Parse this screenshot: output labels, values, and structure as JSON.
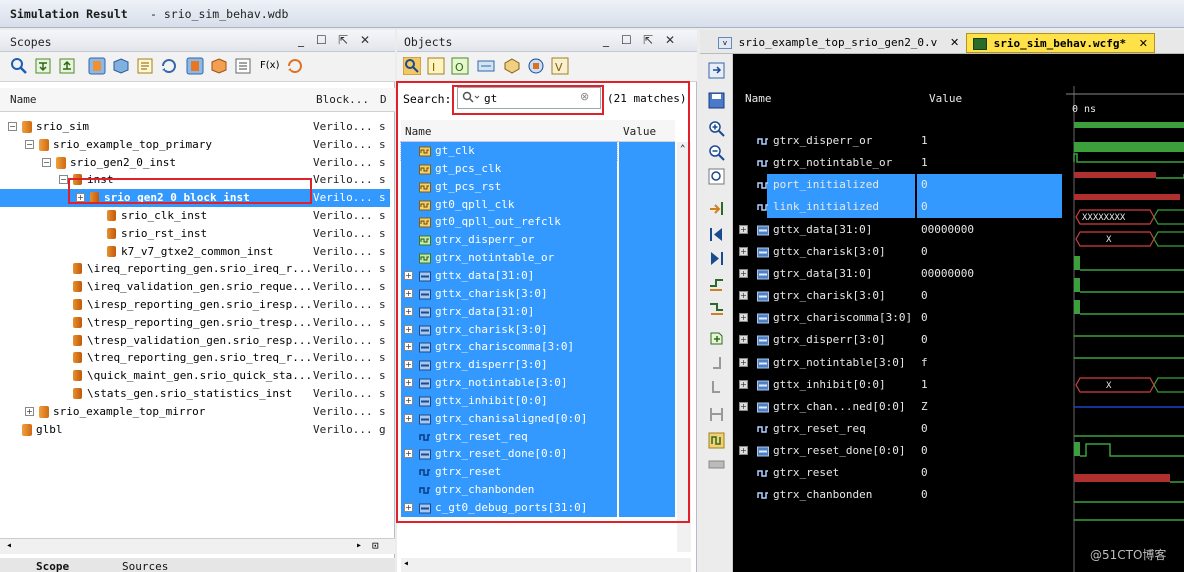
{
  "window": {
    "title": "Simulation Result",
    "subtitle": "- srio_sim_behav.wdb"
  },
  "scopes": {
    "title": "Scopes",
    "columns": {
      "name": "Name",
      "block": "Block...",
      "design": "D"
    },
    "rows": [
      {
        "name": "srio_sim",
        "block": "Verilo...",
        "d": "s",
        "level": 0,
        "exp": "−"
      },
      {
        "name": "srio_example_top_primary",
        "block": "Verilo...",
        "d": "s",
        "level": 1,
        "exp": "−"
      },
      {
        "name": "srio_gen2_0_inst",
        "block": "Verilo...",
        "d": "s",
        "level": 2,
        "exp": "−"
      },
      {
        "name": "inst",
        "block": "Verilo...",
        "d": "s",
        "level": 3,
        "exp": "−"
      },
      {
        "name": "srio_gen2_0_block_inst",
        "block": "Verilo...",
        "d": "s",
        "level": 4,
        "exp": "+",
        "selected": true
      },
      {
        "name": "srio_clk_inst",
        "block": "Verilo...",
        "d": "s",
        "level": 5,
        "exp": ""
      },
      {
        "name": "srio_rst_inst",
        "block": "Verilo...",
        "d": "s",
        "level": 5,
        "exp": ""
      },
      {
        "name": "k7_v7_gtxe2_common_inst",
        "block": "Verilo...",
        "d": "s",
        "level": 5,
        "exp": ""
      },
      {
        "name": "\\ireq_reporting_gen.srio_ireq_r...",
        "block": "Verilo...",
        "d": "s",
        "level": 3,
        "exp": ""
      },
      {
        "name": "\\ireq_validation_gen.srio_reque...",
        "block": "Verilo...",
        "d": "s",
        "level": 3,
        "exp": ""
      },
      {
        "name": "\\iresp_reporting_gen.srio_iresp...",
        "block": "Verilo...",
        "d": "s",
        "level": 3,
        "exp": ""
      },
      {
        "name": "\\tresp_reporting_gen.srio_tresp...",
        "block": "Verilo...",
        "d": "s",
        "level": 3,
        "exp": ""
      },
      {
        "name": "\\tresp_validation_gen.srio_resp...",
        "block": "Verilo...",
        "d": "s",
        "level": 3,
        "exp": ""
      },
      {
        "name": "\\treq_reporting_gen.srio_treq_r...",
        "block": "Verilo...",
        "d": "s",
        "level": 3,
        "exp": ""
      },
      {
        "name": "\\quick_maint_gen.srio_quick_sta...",
        "block": "Verilo...",
        "d": "s",
        "level": 3,
        "exp": ""
      },
      {
        "name": "\\stats_gen.srio_statistics_inst",
        "block": "Verilo...",
        "d": "s",
        "level": 3,
        "exp": ""
      },
      {
        "name": "srio_example_top_mirror",
        "block": "Verilo...",
        "d": "s",
        "level": 1,
        "exp": "+"
      },
      {
        "name": "glbl",
        "block": "Verilo...",
        "d": "g",
        "level": 0,
        "exp": ""
      }
    ],
    "tabs": [
      "Scope",
      "Sources"
    ]
  },
  "objects": {
    "title": "Objects",
    "search_label": "Search:",
    "search_value": "gt",
    "matches": "(21 matches)",
    "columns": {
      "name": "Name",
      "value": "Value"
    },
    "rows": [
      {
        "name": "gt_clk",
        "exp": "",
        "icon": "clock"
      },
      {
        "name": "gt_pcs_clk",
        "exp": "",
        "icon": "clock"
      },
      {
        "name": "gt_pcs_rst",
        "exp": "",
        "icon": "clock"
      },
      {
        "name": "gt0_qpll_clk",
        "exp": "",
        "icon": "clock"
      },
      {
        "name": "gt0_qpll_out_refclk",
        "exp": "",
        "icon": "clock"
      },
      {
        "name": "gtrx_disperr_or",
        "exp": "",
        "icon": "wire"
      },
      {
        "name": "gtrx_notintable_or",
        "exp": "",
        "icon": "wire"
      },
      {
        "name": "gttx_data[31:0]",
        "exp": "+",
        "icon": "bus"
      },
      {
        "name": "gttx_charisk[3:0]",
        "exp": "+",
        "icon": "bus"
      },
      {
        "name": "gtrx_data[31:0]",
        "exp": "+",
        "icon": "bus"
      },
      {
        "name": "gtrx_charisk[3:0]",
        "exp": "+",
        "icon": "bus"
      },
      {
        "name": "gtrx_chariscomma[3:0]",
        "exp": "+",
        "icon": "bus"
      },
      {
        "name": "gtrx_disperr[3:0]",
        "exp": "+",
        "icon": "bus"
      },
      {
        "name": "gtrx_notintable[3:0]",
        "exp": "+",
        "icon": "bus"
      },
      {
        "name": "gttx_inhibit[0:0]",
        "exp": "+",
        "icon": "bus"
      },
      {
        "name": "gtrx_chanisaligned[0:0]",
        "exp": "+",
        "icon": "bus"
      },
      {
        "name": "gtrx_reset_req",
        "exp": "",
        "icon": "sig"
      },
      {
        "name": "gtrx_reset_done[0:0]",
        "exp": "+",
        "icon": "bus"
      },
      {
        "name": "gtrx_reset",
        "exp": "",
        "icon": "sig"
      },
      {
        "name": "gtrx_chanbonden",
        "exp": "",
        "icon": "sig"
      },
      {
        "name": "c_gt0_debug_ports[31:0]",
        "exp": "+",
        "icon": "bus"
      }
    ]
  },
  "wave": {
    "tabs": [
      {
        "label": "srio_example_top_srio_gen2_0.v",
        "active": false
      },
      {
        "label": "srio_sim_behav.wcfg*",
        "active": true
      }
    ],
    "name_header": "Name",
    "value_header": "Value",
    "time_label": "0 ns",
    "rows": [
      {
        "name": "gtrx_disperr_or",
        "value": "1",
        "exp": "",
        "hl": false
      },
      {
        "name": "gtrx_notintable_or",
        "value": "1",
        "exp": "",
        "hl": false
      },
      {
        "name": "port_initialized",
        "value": "0",
        "exp": "",
        "hl": true
      },
      {
        "name": "link_initialized",
        "value": "0",
        "exp": "",
        "hl": true
      },
      {
        "name": "gttx_data[31:0]",
        "value": "00000000",
        "exp": "+",
        "hl": false
      },
      {
        "name": "gttx_charisk[3:0]",
        "value": "0",
        "exp": "+",
        "hl": false
      },
      {
        "name": "gtrx_data[31:0]",
        "value": "00000000",
        "exp": "+",
        "hl": false
      },
      {
        "name": "gtrx_charisk[3:0]",
        "value": "0",
        "exp": "+",
        "hl": false
      },
      {
        "name": "gtrx_chariscomma[3:0]",
        "value": "0",
        "exp": "+",
        "hl": false
      },
      {
        "name": "gtrx_disperr[3:0]",
        "value": "0",
        "exp": "+",
        "hl": false
      },
      {
        "name": "gtrx_notintable[3:0]",
        "value": "f",
        "exp": "+",
        "hl": false
      },
      {
        "name": "gttx_inhibit[0:0]",
        "value": "1",
        "exp": "+",
        "hl": false
      },
      {
        "name": "gtrx_chan...ned[0:0]",
        "value": "Z",
        "exp": "+",
        "hl": false
      },
      {
        "name": "gtrx_reset_req",
        "value": "0",
        "exp": "",
        "hl": false
      },
      {
        "name": "gtrx_reset_done[0:0]",
        "value": "0",
        "exp": "+",
        "hl": false
      },
      {
        "name": "gtrx_reset",
        "value": "0",
        "exp": "",
        "hl": false
      },
      {
        "name": "gtrx_chanbonden",
        "value": "0",
        "exp": "",
        "hl": false
      }
    ],
    "wave_labels": {
      "gttx_data": "XXXXXXXX",
      "gttx_charisk": "X",
      "gttx_inhibit": "X"
    }
  },
  "watermark": "@51CTO博客"
}
